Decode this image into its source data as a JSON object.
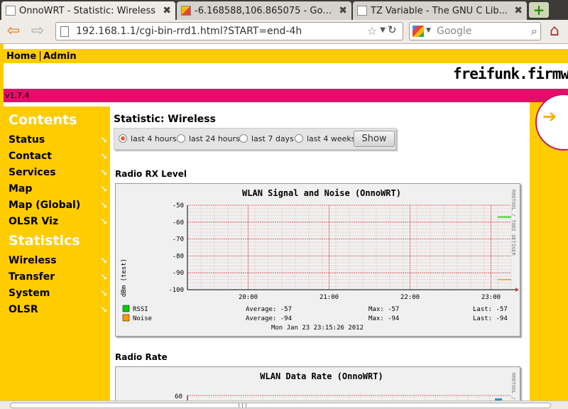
{
  "browser": {
    "tabs": [
      {
        "label": "OnnoWRT - Statistic: Wireless",
        "active": true
      },
      {
        "label": "-6.168588,106.865075 - Goo...",
        "active": false
      },
      {
        "label": "TZ Variable - The GNU C Lib...",
        "active": false
      }
    ],
    "url": "192.168.1.1/cgi-bin-rrd1.html?START=end-4h",
    "search_placeholder": "Google",
    "new_tab_label": "+"
  },
  "topnav": {
    "home": "Home",
    "admin": "Admin"
  },
  "brand": "freifunk.firmware",
  "version": "v1.7.4",
  "sidebar": {
    "contents_heading": "Contents",
    "contents_items": [
      "Status",
      "Contact",
      "Services",
      "Map",
      "Map (Global)",
      "OLSR Viz"
    ],
    "statistics_heading": "Statistics",
    "statistics_items": [
      "Wireless",
      "Transfer",
      "System",
      "OLSR"
    ]
  },
  "page_title": "Statistic: Wireless",
  "range_options": {
    "options": [
      "last 4 hours",
      "last 24 hours",
      "last 7 days",
      "last 4 weeks"
    ],
    "selected": "last 4 hours",
    "show_label": "Show"
  },
  "sections": {
    "rx_title": "Radio RX Level",
    "rate_title": "Radio Rate"
  },
  "graph_rx": {
    "title": "WLAN Signal and Noise (OnnoWRT)",
    "ylabel": "dBm (test)",
    "side_text": "RRDTOOL / TOBI OETIKER",
    "yticks": [
      "-50",
      "-60",
      "-70",
      "-80",
      "-90",
      "-100"
    ],
    "xticks": [
      "20:00",
      "21:00",
      "22:00",
      "23:00"
    ],
    "legend": [
      {
        "name": "RSSI",
        "color": "#00cc00",
        "average": "Average: -57",
        "max": "Max: -57",
        "last": "Last: -57"
      },
      {
        "name": "Noise",
        "color": "#ff9900",
        "average": "Average: -94",
        "max": "Max: -94",
        "last": "Last: -94"
      }
    ],
    "timestamp": "Mon Jan 23 23:15:26 2012"
  },
  "graph_rate": {
    "title": "WLAN Data Rate (OnnoWRT)",
    "side_text": "RRDTOOL /",
    "yticks": [
      "60"
    ]
  },
  "chart_data": [
    {
      "type": "line",
      "title": "WLAN Signal and Noise (OnnoWRT)",
      "ylabel": "dBm (test)",
      "xlabel": "",
      "ylim": [
        -100,
        -50
      ],
      "xticks": [
        "20:00",
        "21:00",
        "22:00",
        "23:00"
      ],
      "series": [
        {
          "name": "RSSI",
          "color": "#00cc00",
          "x": [
            "23:05",
            "23:15"
          ],
          "values": [
            -57,
            -57
          ]
        },
        {
          "name": "Noise",
          "color": "#ff9900",
          "x": [
            "23:05",
            "23:15"
          ],
          "values": [
            -94,
            -94
          ]
        }
      ],
      "grid": true
    }
  ]
}
